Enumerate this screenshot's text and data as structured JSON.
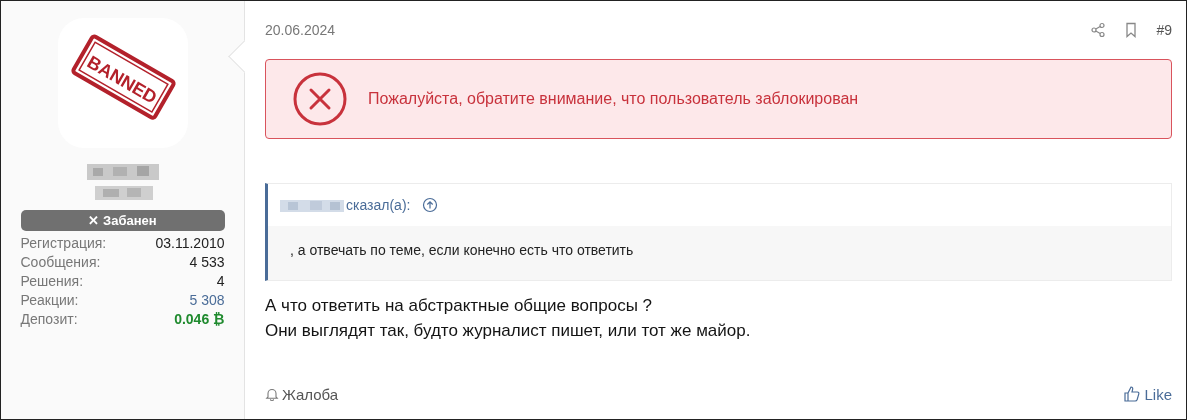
{
  "user": {
    "avatar": {
      "stamp_text": "BANNED"
    },
    "banner": {
      "icon": "✕",
      "label": "Забанен"
    },
    "stats": [
      {
        "label": "Регистрация:",
        "value": "03.11.2010",
        "kind": "plain"
      },
      {
        "label": "Сообщения:",
        "value": "4 533",
        "kind": "plain"
      },
      {
        "label": "Решения:",
        "value": "4",
        "kind": "plain"
      },
      {
        "label": "Реакции:",
        "value": "5 308",
        "kind": "link"
      },
      {
        "label": "Депозит:",
        "value": "0.046 ₿",
        "kind": "deposit"
      }
    ]
  },
  "post": {
    "date": "20.06.2024",
    "number": "#9",
    "alert": "Пожалуйста, обратите внимание, что пользователь заблокирован",
    "quote": {
      "said": "сказал(а):",
      "text": ", а отвечать по теме, если конечно есть что ответить"
    },
    "body": [
      "А что ответить на абстрактные общие вопросы ?",
      "Они выглядят так, будто журналист пишет, или тот же майор."
    ],
    "report": "Жалоба",
    "like": "Like"
  }
}
